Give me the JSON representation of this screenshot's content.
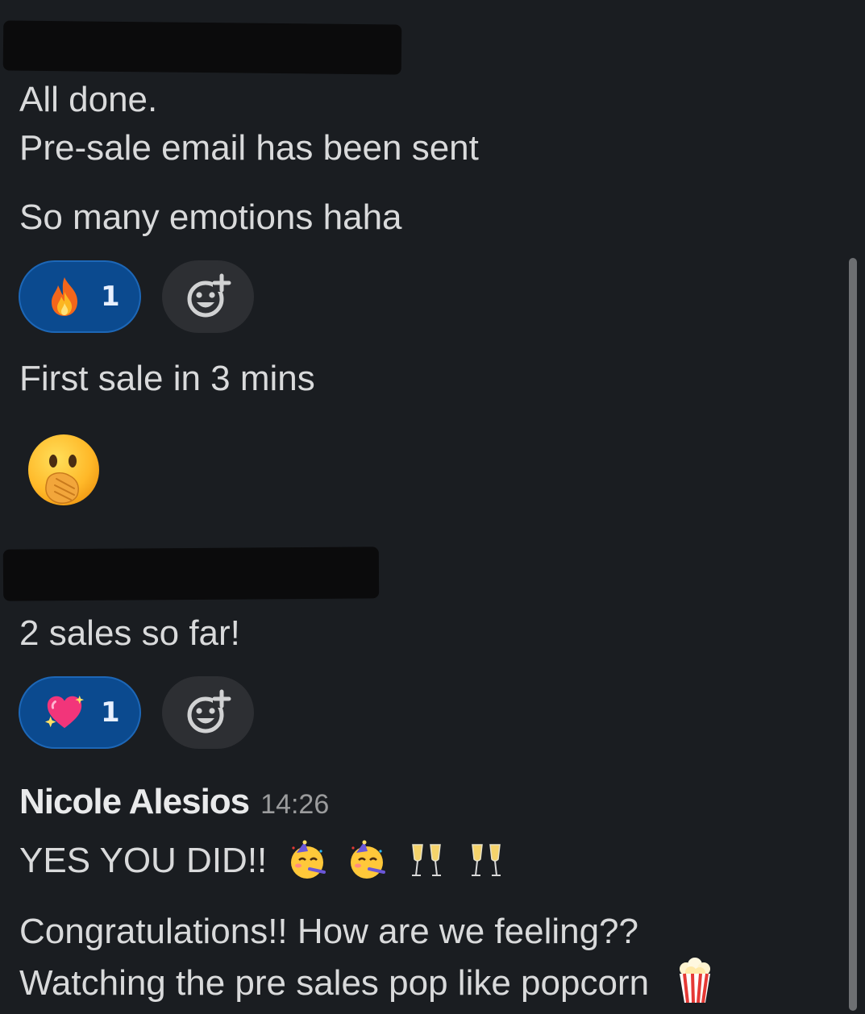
{
  "messages": {
    "m1_line1": "All done.",
    "m1_line2": "Pre-sale email has been sent",
    "m2": "So many emotions haha",
    "m3": "First sale in 3 mins",
    "m4": "2 sales so far!",
    "m5_text": "YES YOU DID!!",
    "m6_line1": "Congratulations!! How are we feeling??",
    "m6_line2": "Watching the pre sales pop like popcorn"
  },
  "reactions_1": {
    "emoji": "fire-icon",
    "count": "1"
  },
  "reactions_2": {
    "emoji": "sparkling-heart-icon",
    "count": "1"
  },
  "big_emoji": "face-with-hand-over-mouth-icon",
  "author": {
    "name": "Nicole Alesios",
    "time": "14:26"
  },
  "inline_emojis": [
    "partying-face-icon",
    "partying-face-icon",
    "champagne-glasses-icon",
    "champagne-glasses-icon",
    "popcorn-icon"
  ],
  "colors": {
    "background": "#1a1d21",
    "text": "#d9dadb",
    "reaction_pill": "#0b4a8f",
    "reaction_border": "#1d67b7",
    "add_reaction_bg": "#2d2f33",
    "timestamp": "#9b9c9d"
  }
}
